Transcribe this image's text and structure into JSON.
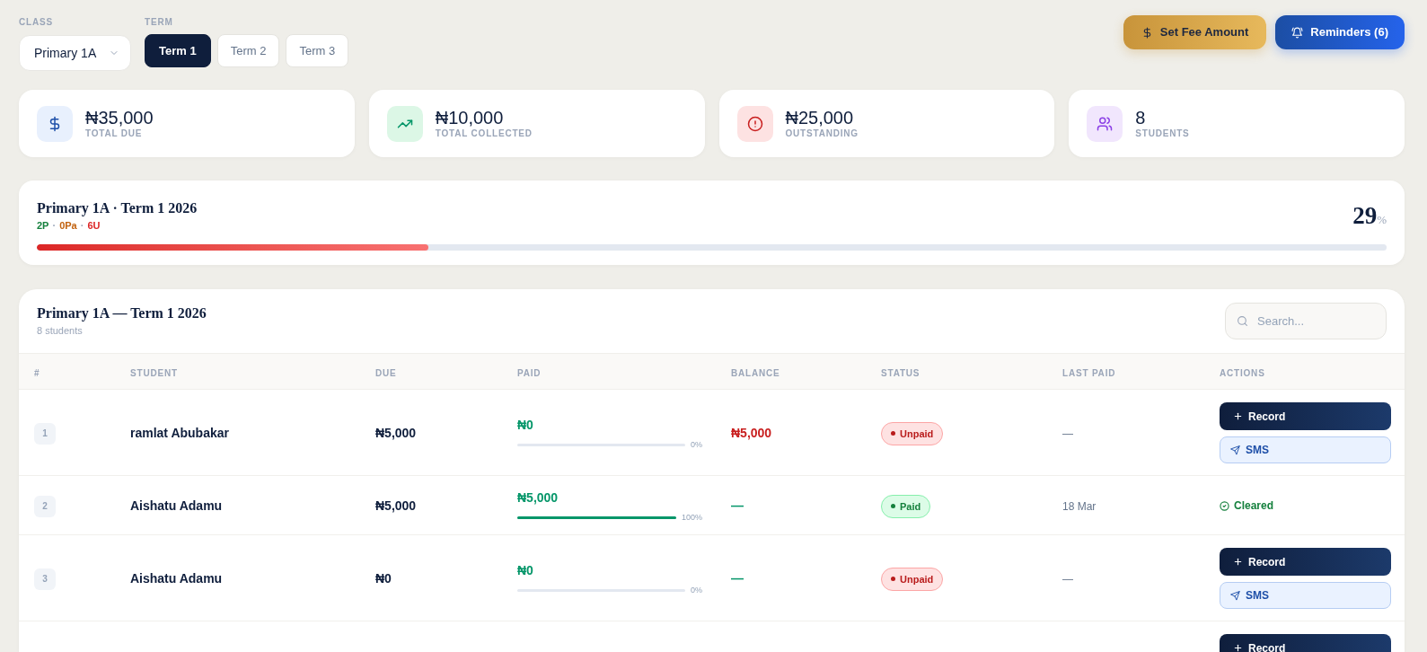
{
  "filters": {
    "class_select": {
      "label": "CLASS",
      "value": "Primary 1A"
    },
    "term": {
      "label": "TERM",
      "tabs": [
        {
          "label": "Term 1",
          "selected": true
        },
        {
          "label": "Term 2",
          "selected": false
        },
        {
          "label": "Term 3",
          "selected": false
        }
      ]
    }
  },
  "header_buttons": [
    {
      "kind": "fee",
      "label": "Set Fee Amount"
    },
    {
      "kind": "reminders",
      "label": "Reminders (6)"
    }
  ],
  "stats": [
    {
      "kind": "due",
      "value": "₦35,000",
      "label": "TOTAL DUE"
    },
    {
      "kind": "collected",
      "value": "₦10,000",
      "label": "TOTAL COLLECTED"
    },
    {
      "kind": "outstanding",
      "value": "₦25,000",
      "label": "OUTSTANDING"
    },
    {
      "kind": "students",
      "value": "8",
      "label": "STUDENTS"
    }
  ],
  "progress": {
    "title": "Primary 1A · Term 1 2026",
    "counts": [
      {
        "kind": "count",
        "text": "2P",
        "color": "#15803d"
      },
      {
        "kind": "separator",
        "text": "·"
      },
      {
        "kind": "count",
        "text": "0Pa",
        "color": "#c2620f"
      },
      {
        "kind": "separator",
        "text": "·"
      },
      {
        "kind": "count",
        "text": "6U",
        "color": "#dc2626"
      }
    ],
    "level": 0.29,
    "percent": "29",
    "percent_sign": "%"
  },
  "table": {
    "title": "Primary 1A — Term 1 2026",
    "subtitle": "8 students",
    "search": {
      "placeholder": "Search..."
    },
    "columns": [
      "#",
      "STUDENT",
      "DUE",
      "PAID",
      "BALANCE",
      "STATUS",
      "LAST PAID",
      "ACTIONS"
    ],
    "rows": [
      {
        "number": "1",
        "student": "ramlat Abubakar",
        "due": "₦5,000",
        "paid": "₦0",
        "level": 0,
        "paid_percent": "0%",
        "balance": "₦5,000",
        "owing": true,
        "status": {
          "kind": "unpaid",
          "label": "Unpaid"
        },
        "last_paid": "—",
        "actions": [
          {
            "kind": "record",
            "label": "Record"
          },
          {
            "kind": "sms",
            "label": "SMS"
          }
        ]
      },
      {
        "number": "2",
        "student": "Aishatu Adamu",
        "due": "₦5,000",
        "paid": "₦5,000",
        "level": 1,
        "paid_percent": "100%",
        "balance": "—",
        "owing": false,
        "status": {
          "kind": "paid",
          "label": "Paid"
        },
        "last_paid": "18 Mar",
        "actions": [
          {
            "kind": "cleared",
            "label": "Cleared"
          }
        ]
      },
      {
        "number": "3",
        "student": "Aishatu Adamu",
        "due": "₦0",
        "paid": "₦0",
        "level": 0,
        "paid_percent": "0%",
        "balance": "—",
        "owing": false,
        "status": {
          "kind": "unpaid",
          "label": "Unpaid"
        },
        "last_paid": "—",
        "actions": [
          {
            "kind": "record",
            "label": "Record"
          },
          {
            "kind": "sms",
            "label": "SMS"
          }
        ]
      },
      {
        "actions": [
          {
            "kind": "record",
            "label": "Record"
          }
        ]
      }
    ]
  }
}
